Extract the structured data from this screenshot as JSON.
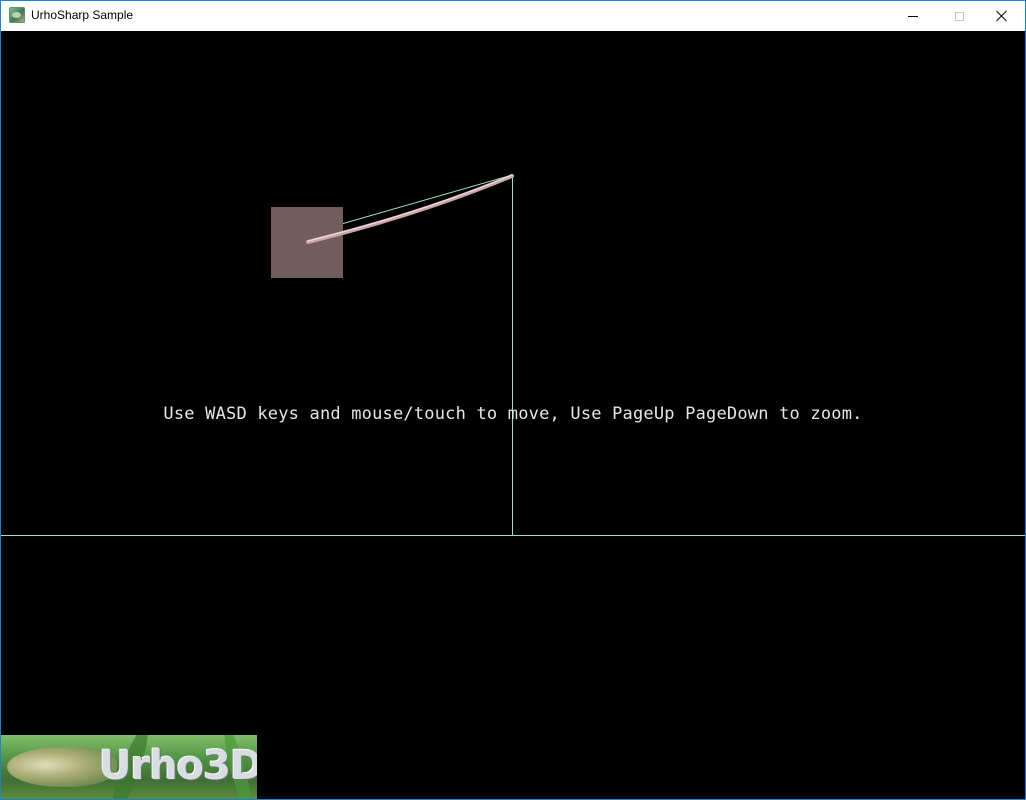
{
  "window": {
    "title": "UrhoSharp Sample",
    "icon": "app-icon"
  },
  "controls": {
    "minimize": "minimize-icon",
    "maximize": "maximize-icon",
    "close": "close-icon"
  },
  "scene": {
    "instructions": "Use WASD keys and mouse/touch to move, Use PageUp PageDown to zoom.",
    "logo_text": "Urho3D",
    "colors": {
      "background": "#000000",
      "box": "#735c5c",
      "rope": "#c9a6a6",
      "debug_lines": "#9fe0d4",
      "text": "#e6e6e6"
    }
  }
}
